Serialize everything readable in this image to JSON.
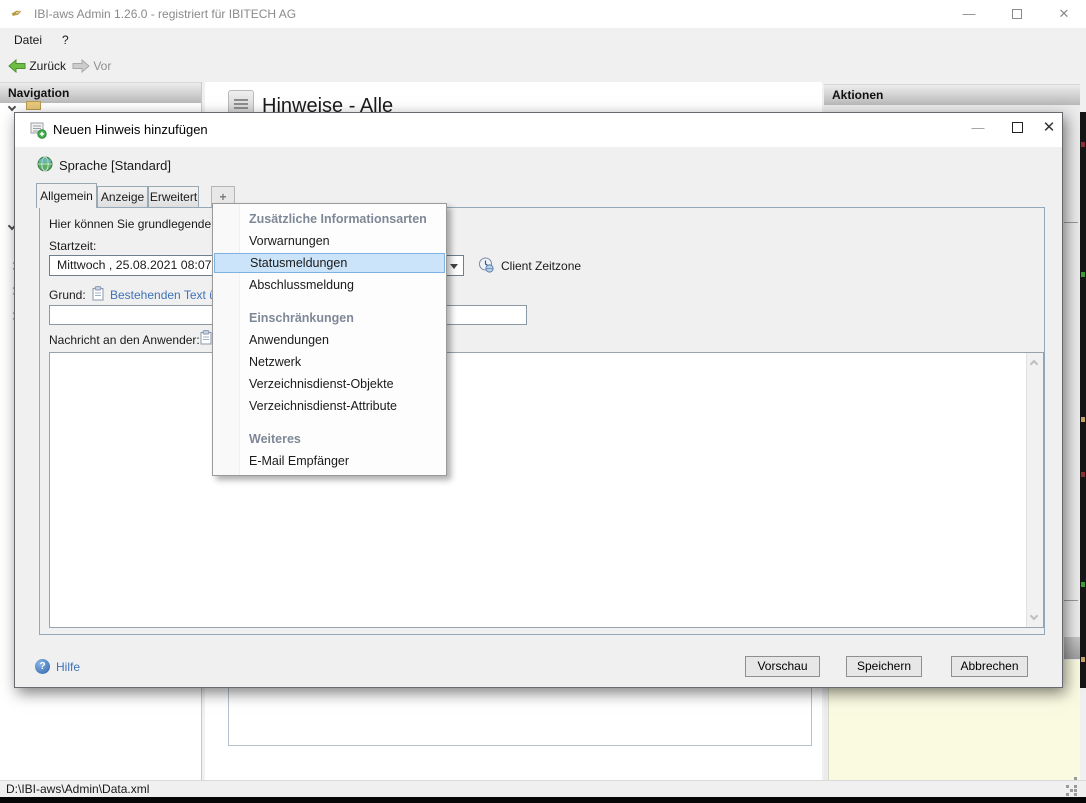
{
  "window": {
    "title": "IBI-aws Admin 1.26.0 - registriert für IBITECH AG",
    "menu": [
      {
        "label": "Datei"
      },
      {
        "label": "?"
      }
    ],
    "toolbar": {
      "back": "Zurück",
      "forward": "Vor"
    },
    "panels": {
      "navigation": "Navigation",
      "content": "Hinweise - Alle",
      "actions": "Aktionen"
    },
    "controls": {
      "minimize": "–",
      "maximize": "",
      "close": "✕"
    },
    "statusbar": {
      "path": "D:\\IBI-aws\\Admin\\Data.xml"
    }
  },
  "dialog": {
    "title": "Neuen Hinweis hinzufügen",
    "language": "Sprache [Standard]",
    "tabs": [
      {
        "label": "Allgemein"
      },
      {
        "label": "Anzeige"
      },
      {
        "label": "Erweitert"
      }
    ],
    "add_tab": "+",
    "intro": "Hier können Sie grundlegende Ei",
    "start_time": {
      "label": "Startzeit:",
      "value": "Mittwoch , 25.08.2021  08:07"
    },
    "client_timezone": "Client Zeitzone",
    "reason": {
      "label": "Grund:",
      "link": "Bestehenden Text üb",
      "value": ""
    },
    "message": {
      "label": "Nachricht an den Anwender:",
      "value": ""
    },
    "help": "Hilfe",
    "buttons": {
      "preview": "Vorschau",
      "save": "Speichern",
      "cancel": "Abbrechen"
    }
  },
  "popup_menu": {
    "selected_item": "Statusmeldungen",
    "rows": [
      {
        "type": "header",
        "label": "Zusätzliche Informationsarten"
      },
      {
        "type": "item",
        "label": "Vorwarnungen"
      },
      {
        "type": "item-selected",
        "label": "Statusmeldungen"
      },
      {
        "type": "item",
        "label": "Abschlussmeldung"
      },
      {
        "type": "spacer",
        "label": ""
      },
      {
        "type": "header",
        "label": "Einschränkungen"
      },
      {
        "type": "item",
        "label": "Anwendungen"
      },
      {
        "type": "item",
        "label": "Netzwerk"
      },
      {
        "type": "item",
        "label": "Verzeichnisdienst-Objekte"
      },
      {
        "type": "item",
        "label": "Verzeichnisdienst-Attribute"
      },
      {
        "type": "spacer",
        "label": ""
      },
      {
        "type": "header",
        "label": "Weiteres"
      },
      {
        "type": "item",
        "label": "E-Mail Empfänger"
      }
    ]
  },
  "colors": {
    "selection_bg": "#cbe4f9",
    "selection_border": "#7fb2e0",
    "link": "#3f72b8",
    "menu_header_text": "#7e8896",
    "actions_panel_bg": "#fafae1",
    "back_arrow": "#6fbe44"
  }
}
